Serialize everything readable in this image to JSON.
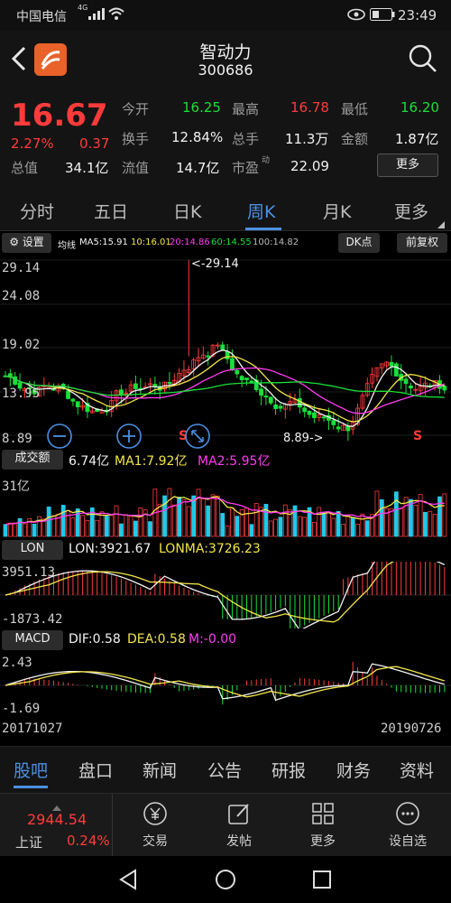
{
  "status": {
    "carrier": "中国电信",
    "network": "4G",
    "time": "23:49"
  },
  "header": {
    "name": "智动力",
    "code": "300686"
  },
  "quote": {
    "price": "16.67",
    "change_pct": "2.27%",
    "change": "0.37",
    "open_label": "今开",
    "open": "16.25",
    "high_label": "最高",
    "high": "16.78",
    "low_label": "最低",
    "low": "16.20",
    "turnover_label": "换手",
    "turnover": "12.84%",
    "volume_label": "总手",
    "volume": "11.3万",
    "amount_label": "金额",
    "amount": "1.87亿",
    "mktcap_label": "总值",
    "mktcap": "34.1亿",
    "float_label": "流值",
    "float": "14.7亿",
    "pe_label": "市盈",
    "pe_sup": "动",
    "pe": "22.09",
    "more": "更多"
  },
  "tabs": [
    "分时",
    "五日",
    "日K",
    "周K",
    "月K",
    "更多"
  ],
  "active_tab": 3,
  "kline": {
    "settings": "设置",
    "ma_title": "均线",
    "ma5": "MA5:15.91",
    "ma10": "10:16.01",
    "ma20": "20:14.86",
    "ma60": "60:14.55",
    "ma100": "100:14.82",
    "dk": "DK点",
    "fq": "前复权",
    "y_labels": [
      "29.14",
      "24.08",
      "19.02",
      "13.95",
      "8.89"
    ],
    "max_mark": "<-29.14",
    "min_mark": "8.89->",
    "s_mark": "S"
  },
  "volume": {
    "btn": "成交额",
    "value": "6.74亿",
    "ma1": "MA1:7.92亿",
    "ma2": "MA2:5.95亿",
    "y_top": "31亿"
  },
  "lon": {
    "btn": "LON",
    "value": "LON:3921.67",
    "lonma": "LONMA:3726.23",
    "y_top": "3951.13",
    "y_bottom": "-1873.42"
  },
  "macd": {
    "btn": "MACD",
    "dif": "DIF:0.58",
    "dea": "DEA:0.58",
    "m": "M:-0.00",
    "y_top": "2.43",
    "y_bottom": "-1.69"
  },
  "dates": {
    "start": "20171027",
    "end": "20190726"
  },
  "bottom_tabs": [
    "股吧",
    "盘口",
    "新闻",
    "公告",
    "研报",
    "财务",
    "资料"
  ],
  "toolbar": {
    "index_value": "2944.54",
    "index_name": "上证",
    "index_pct": "0.24%",
    "items": [
      "交易",
      "发帖",
      "更多",
      "设自选"
    ]
  },
  "colors": {
    "up": "#ff3b3b",
    "down": "#19e03a",
    "accent": "#4a90e2"
  }
}
